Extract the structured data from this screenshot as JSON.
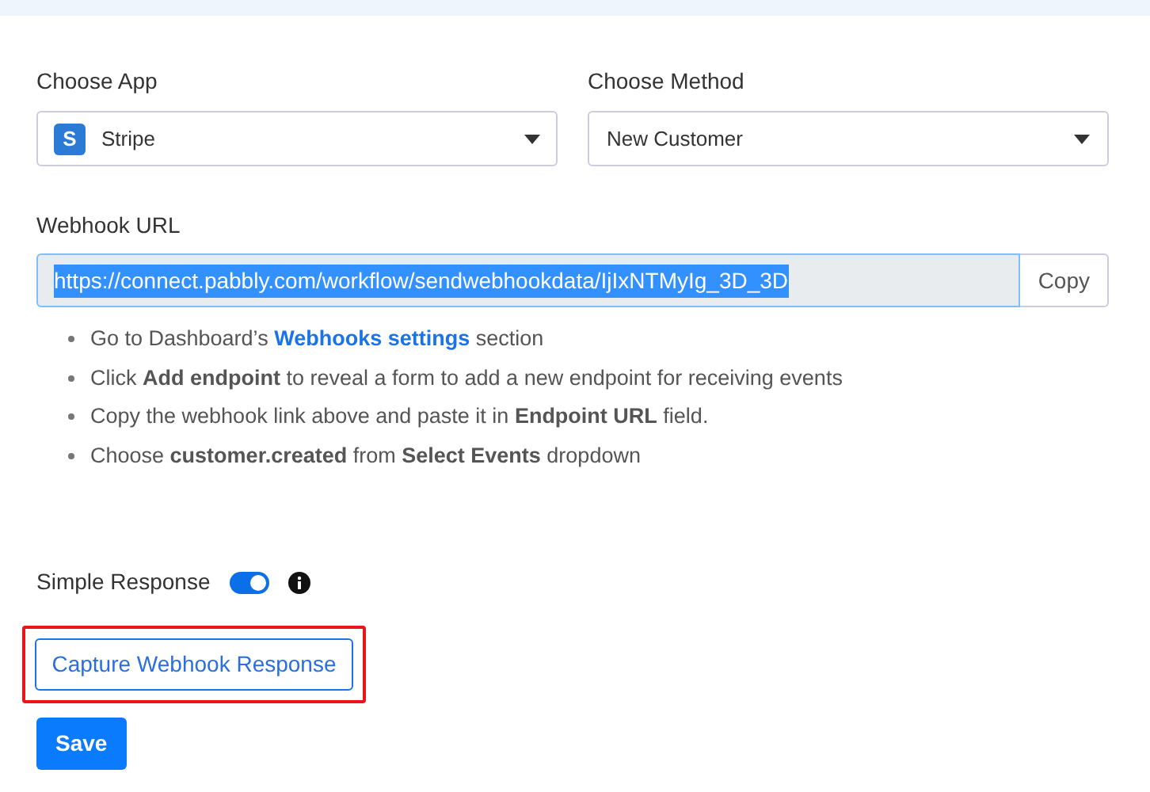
{
  "app_select": {
    "label": "Choose App",
    "value": "Stripe",
    "icon_letter": "S"
  },
  "method_select": {
    "label": "Choose Method",
    "value": "New Customer"
  },
  "webhook": {
    "label": "Webhook URL",
    "value": "https://connect.pabbly.com/workflow/sendwebhookdata/IjIxNTMyIg_3D_3D",
    "text_selected": true,
    "copy_button": "Copy"
  },
  "instructions": [
    [
      {
        "kind": "text",
        "text": "Go to Dashboard’s "
      },
      {
        "kind": "link",
        "text": "Webhooks settings"
      },
      {
        "kind": "text",
        "text": " section"
      }
    ],
    [
      {
        "kind": "text",
        "text": "Click "
      },
      {
        "kind": "bold",
        "text": "Add endpoint"
      },
      {
        "kind": "text",
        "text": " to reveal a form to add a new endpoint for receiving events"
      }
    ],
    [
      {
        "kind": "text",
        "text": "Copy the webhook link above and paste it in "
      },
      {
        "kind": "bold",
        "text": "Endpoint URL"
      },
      {
        "kind": "text",
        "text": " field."
      }
    ],
    [
      {
        "kind": "text",
        "text": "Choose "
      },
      {
        "kind": "bold",
        "text": "customer.created"
      },
      {
        "kind": "text",
        "text": " from "
      },
      {
        "kind": "bold",
        "text": "Select Events"
      },
      {
        "kind": "text",
        "text": " dropdown"
      }
    ]
  ],
  "simple_response": {
    "label": "Simple Response",
    "on": true
  },
  "capture_button": {
    "label": "Capture Webhook Response",
    "highlighted": true
  },
  "save_button": "Save"
}
